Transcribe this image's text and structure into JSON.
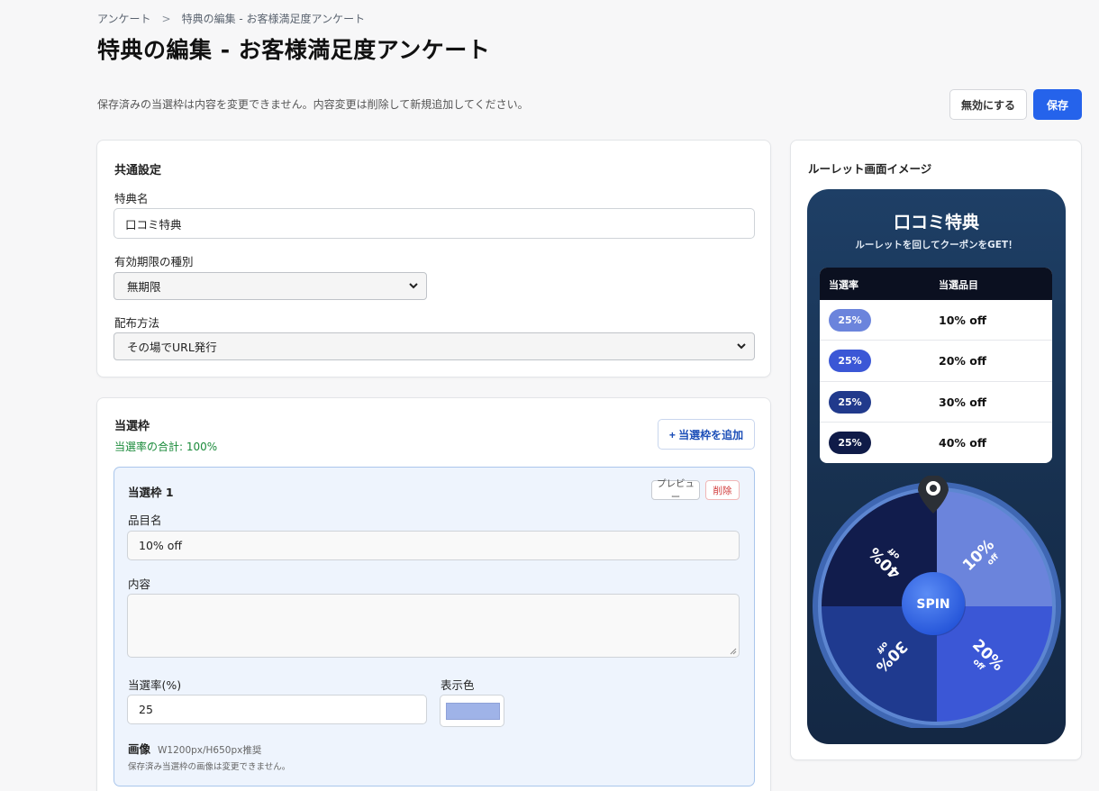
{
  "breadcrumb": {
    "root": "アンケート",
    "separator": ">",
    "current": "特典の編集 - お客様満足度アンケート"
  },
  "page_title": "特典の編集 - お客様満足度アンケート",
  "notice": "保存済みの当選枠は内容を変更できません。内容変更は削除して新規追加してください。",
  "actions": {
    "disable_label": "無効にする",
    "save_label": "保存"
  },
  "common": {
    "title": "共通設定",
    "name_label": "特典名",
    "name_value": "口コミ特典",
    "expiry_label": "有効期限の種別",
    "expiry_value": "無期限",
    "distribution_label": "配布方法",
    "distribution_value": "その場でURL発行"
  },
  "slots": {
    "title": "当選枠",
    "total_rate": "当選率の合計: 100%",
    "add_label": "+ 当選枠を追加",
    "slot": {
      "title": "当選枠 1",
      "preview_label": "プレビュー",
      "delete_label": "削除",
      "item_label": "品目名",
      "item_value": "10% off",
      "content_label": "内容",
      "content_value": "",
      "rate_label": "当選率(%)",
      "rate_value": "25",
      "color_label": "表示色",
      "color_value": "#9fb3e8",
      "image_label": "画像",
      "image_hint": "W1200px/H650px推奨",
      "image_note": "保存済み当選枠の画像は変更できません。"
    }
  },
  "preview": {
    "title": "ルーレット画面イメージ",
    "phone_title": "口コミ特典",
    "phone_subtitle": "ルーレットを回してクーポンをGET！",
    "col_rate": "当選率",
    "col_item": "当選品目",
    "rows": [
      {
        "rate": "25%",
        "item": "10% off",
        "color": "#6b84dc"
      },
      {
        "rate": "25%",
        "item": "20% off",
        "color": "#3b57d6"
      },
      {
        "rate": "25%",
        "item": "30% off",
        "color": "#213a8c"
      },
      {
        "rate": "25%",
        "item": "40% off",
        "color": "#0f1b48"
      }
    ],
    "spin_label": "SPIN",
    "segments": [
      {
        "big": "10%",
        "small": "off",
        "color": "#6b84dc"
      },
      {
        "big": "20%",
        "small": "off",
        "color": "#3b57d6"
      },
      {
        "big": "30%",
        "small": "off",
        "color": "#1f3a8f"
      },
      {
        "big": "40%",
        "small": "off",
        "color": "#111c4c"
      }
    ]
  }
}
